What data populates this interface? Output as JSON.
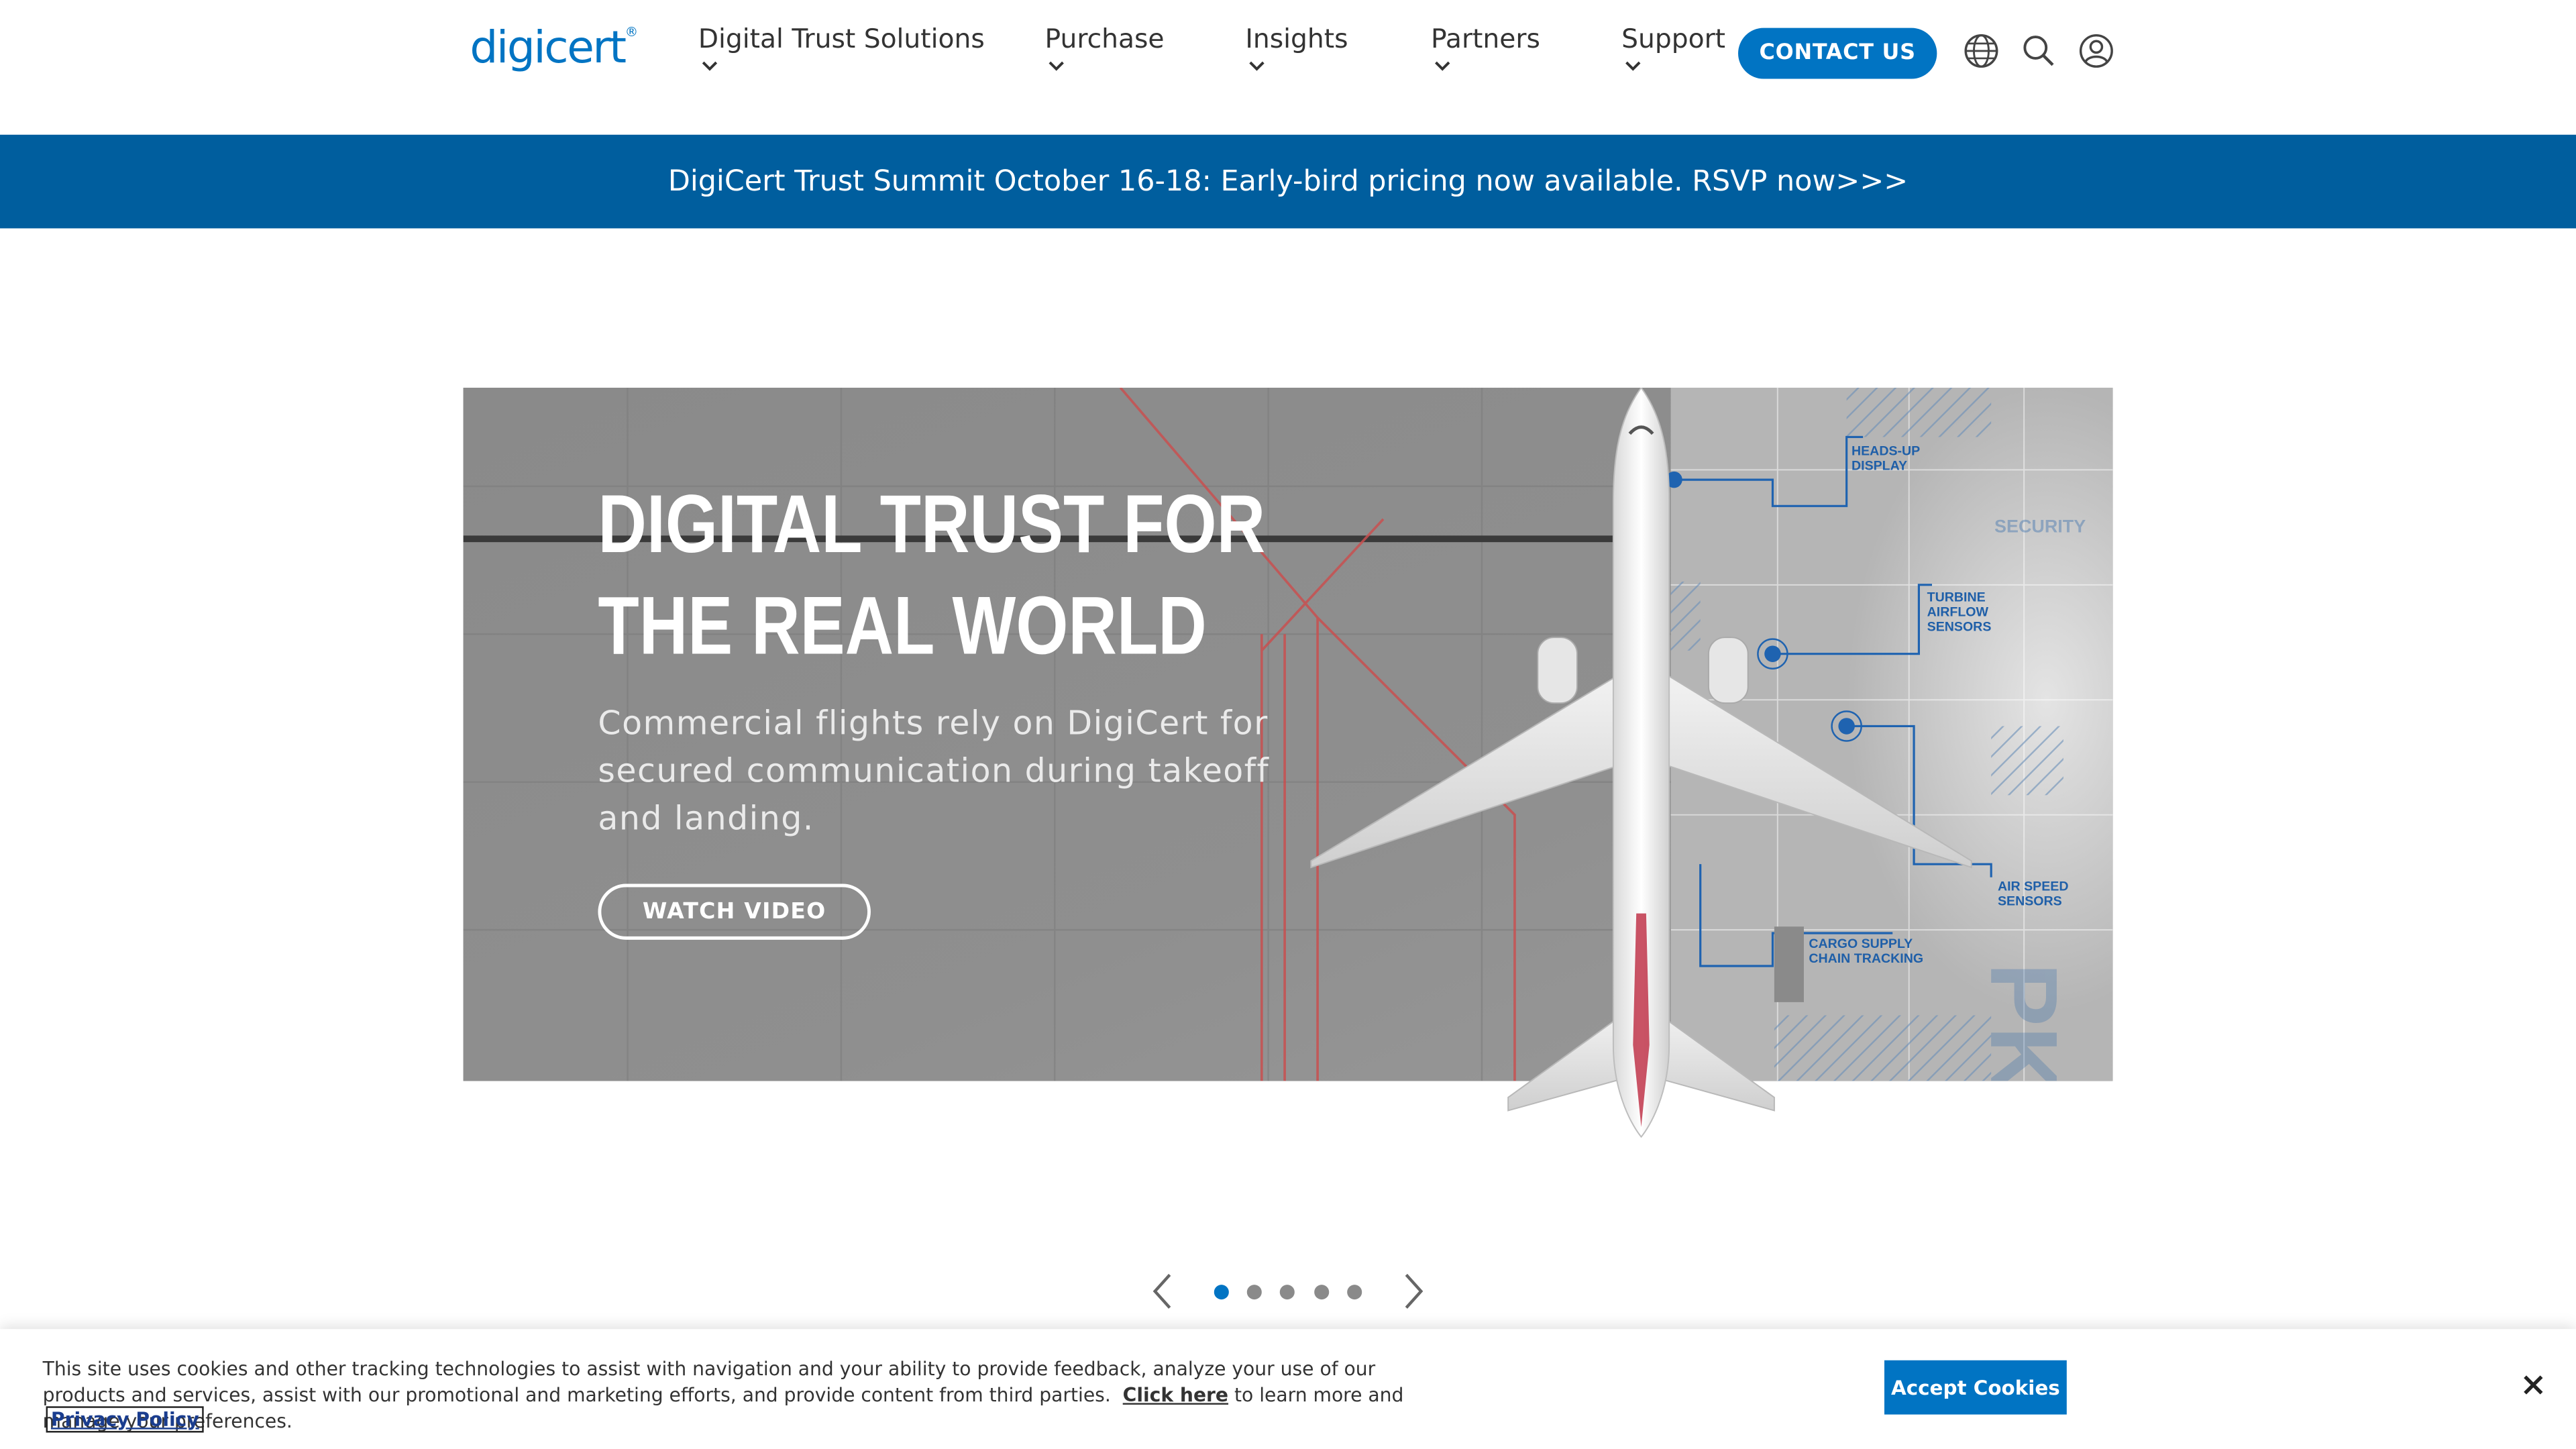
{
  "header": {
    "logo_text": "digicert",
    "nav": [
      {
        "label": "Digital Trust Solutions"
      },
      {
        "label": "Purchase"
      },
      {
        "label": "Insights"
      },
      {
        "label": "Partners"
      },
      {
        "label": "Support"
      }
    ],
    "contact_label": "CONTACT US",
    "icons": [
      "globe-icon",
      "search-icon",
      "user-account-icon"
    ]
  },
  "promo_banner": {
    "text": "DigiCert Trust Summit October 16-18: Early-bird pricing now available. RSVP now>>>"
  },
  "hero": {
    "title": "DIGITAL TRUST FOR\nTHE REAL WORLD",
    "subtitle": "Commercial flights rely on DigiCert for secured communication during takeoff and landing.",
    "button_label": "WATCH VIDEO",
    "callouts": [
      "HEADS-UP DISPLAY",
      "TURBINE AIRFLOW SENSORS",
      "AIR SPEED SENSORS",
      "CARGO SUPPLY CHAIN TRACKING",
      "SECURITY",
      "PKI"
    ]
  },
  "carousel": {
    "slide_count": 5,
    "active_index": 0
  },
  "cookie_banner": {
    "text_before": "This site uses cookies and other tracking technologies to assist with navigation and your ability to provide feedback, analyze your use of our products and services, assist with our promotional and marketing efforts, and provide content from third parties.",
    "link_label": "Click here",
    "text_after": "to learn more and manage your preferences.",
    "privacy_label": "Privacy Policy",
    "accept_label": "Accept Cookies"
  },
  "colors": {
    "brand_blue": "#0174c3",
    "banner_blue": "#005e9e"
  }
}
